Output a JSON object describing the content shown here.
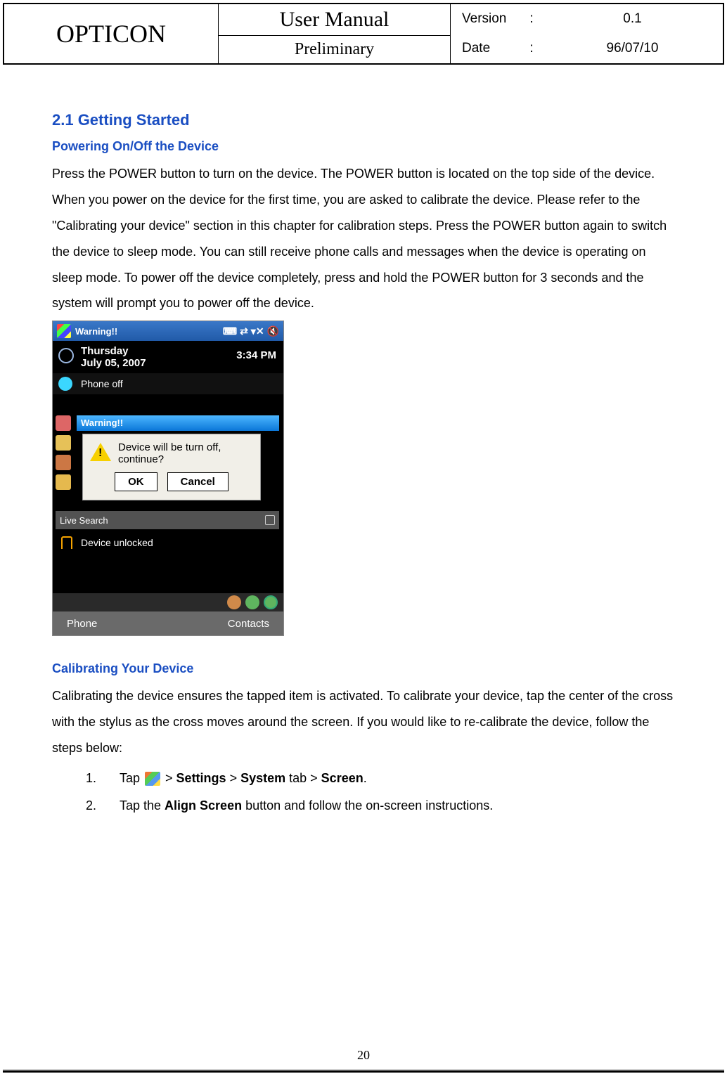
{
  "header": {
    "brand": "OPTICON",
    "title": "User Manual",
    "subtitle": "Preliminary",
    "version_label": "Version",
    "version_value": "0.1",
    "date_label": "Date",
    "date_value": "96/07/10",
    "colon": ":"
  },
  "section": {
    "number_title": "2.1 Getting Started",
    "sub1": "Powering On/Off the Device",
    "para1": "Press the POWER button to turn on the device. The POWER button is located on the top side of the device. When you power on the device for the first time, you are asked to calibrate the device. Please refer to the \"Calibrating your device\" section in this chapter for calibration steps. Press the POWER button again to switch the device to sleep mode. You can still receive phone calls and messages when the device is operating on sleep mode. To power off the device completely, press and hold the POWER button for 3 seconds and the system will prompt you to power off the device.",
    "sub2": "Calibrating Your Device",
    "para2": "Calibrating the device ensures the tapped item is activated. To calibrate your device, tap the center of the cross with the stylus as the cross moves around the screen. If you would like to re-calibrate the device, follow the steps below:",
    "steps": {
      "n1": "1.",
      "t1a": "Tap ",
      "t1b_settings": "Settings",
      "t1b_gt": " > ",
      "t1b_system": "System",
      "t1b_tab": " tab > ",
      "t1b_screen": "Screen",
      "t1b_period": ".",
      "n2": "2.",
      "t2a": "Tap the ",
      "t2b": "Align Screen",
      "t2c": " button and follow the on-screen instructions."
    }
  },
  "screenshot": {
    "topbar": "Warning!!",
    "day": "Thursday",
    "date": "July 05, 2007",
    "time": "3:34 PM",
    "phone_off": "Phone off",
    "warning_bar": "Warning!!",
    "dialog_text": "Device will be turn off, continue?",
    "ok": "OK",
    "cancel": "Cancel",
    "live": "Live Search",
    "unlocked": "Device unlocked",
    "sk_left": "Phone",
    "sk_right": "Contacts"
  },
  "page_number": "20"
}
